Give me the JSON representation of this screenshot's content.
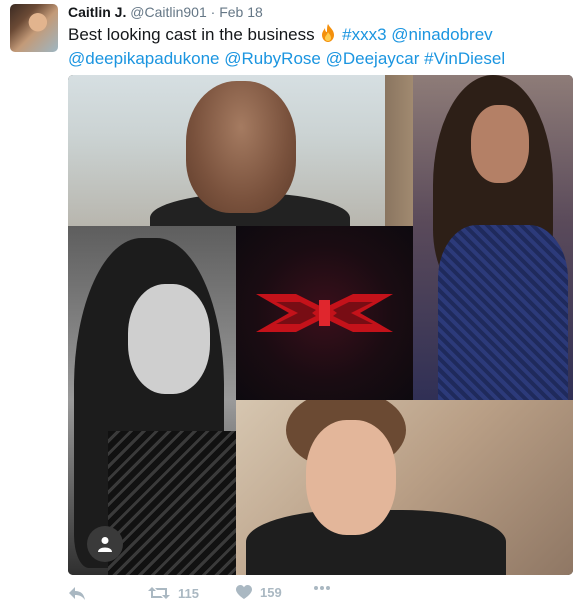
{
  "tweet": {
    "author_name": "Caitlin J.",
    "author_handle": "@Caitlin901",
    "separator": "·",
    "date": "Feb 18",
    "text_plain": "Best looking cast in the business",
    "mentions_line1": [
      "#xxx3",
      "@ninadobrev"
    ],
    "mentions_line2": [
      "@deepikapadukone",
      "@RubyRose",
      "@Deejaycar",
      "#VinDiesel"
    ],
    "emoji": "fire-icon"
  },
  "actions": {
    "reply_icon": "reply-icon",
    "retweet_icon": "retweet-icon",
    "retweet_count": "115",
    "like_icon": "heart-icon",
    "like_count": "159",
    "more_icon": "more-icon"
  },
  "colors": {
    "link": "#1b95e0",
    "muted": "#657786",
    "action": "#aab8c2",
    "logo_red": "#c4121a"
  }
}
